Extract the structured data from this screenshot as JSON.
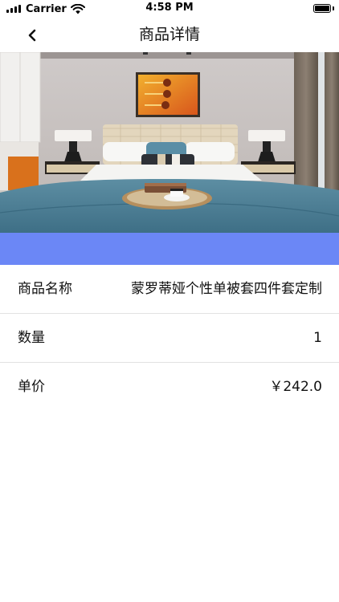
{
  "status_bar": {
    "carrier": "Carrier",
    "time": "4:58 PM"
  },
  "nav": {
    "title": "商品详情",
    "back_icon": "chevron-left-icon"
  },
  "hero": {
    "image": "bedroom-photo",
    "strip_color": "#6b87f6"
  },
  "details": [
    {
      "label": "商品名称",
      "value": "蒙罗蒂娅个性单被套四件套定制"
    },
    {
      "label": "数量",
      "value": "1"
    },
    {
      "label": "单价",
      "value": "￥242.0"
    }
  ]
}
